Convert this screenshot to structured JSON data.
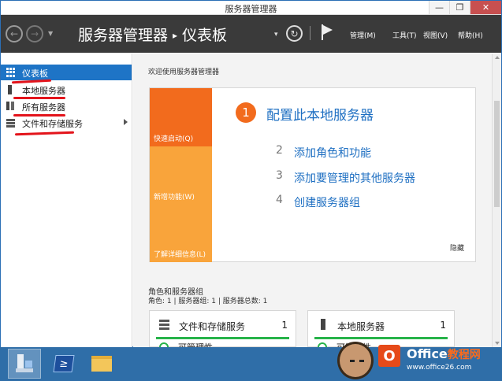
{
  "window": {
    "title": "服务器管理器",
    "minimize": "—",
    "restore": "❐",
    "close": "✕"
  },
  "header": {
    "back": "←",
    "forward": "→",
    "nav_dropdown": "▼",
    "breadcrumb_root": "服务器管理器",
    "breadcrumb_sep": "▸",
    "breadcrumb_current": "仪表板",
    "breadcrumb_dropdown": "▾",
    "refresh": "↻",
    "menus": [
      "管理(M)",
      "工具(T)",
      "视图(V)",
      "帮助(H)"
    ]
  },
  "sidebar": {
    "items": [
      {
        "label": "仪表板",
        "icon": "dashboard-icon",
        "active": true
      },
      {
        "label": "本地服务器",
        "icon": "server-icon",
        "active": false
      },
      {
        "label": "所有服务器",
        "icon": "servers-icon",
        "active": false
      },
      {
        "label": "文件和存储服务",
        "icon": "storage-icon",
        "active": false
      }
    ],
    "annotation_color": "#e3141b"
  },
  "welcome": {
    "title": "欢迎使用服务器管理器",
    "tabs": [
      "快速启动(Q)",
      "新增功能(W)",
      "了解详细信息(L)"
    ],
    "step1": {
      "num": "1",
      "label": "配置此本地服务器"
    },
    "steps": [
      {
        "num": "2",
        "label": "添加角色和功能"
      },
      {
        "num": "3",
        "label": "添加要管理的其他服务器"
      },
      {
        "num": "4",
        "label": "创建服务器组"
      }
    ],
    "hide": "隐藏"
  },
  "roles": {
    "title": "角色和服务器组",
    "summary": "角色: 1 | 服务器组: 1 | 服务器总数: 1",
    "tiles": [
      {
        "name": "文件和存储服务",
        "count": "1",
        "icon": "storage-icon",
        "status": "可管理性"
      },
      {
        "name": "本地服务器",
        "count": "1",
        "icon": "server-icon",
        "status": "可管理性"
      }
    ]
  },
  "taskbar": {
    "apps": [
      "server-manager-icon",
      "powershell-icon",
      "file-explorer-icon"
    ],
    "powershell_glyph": "≥"
  },
  "watermark": {
    "logo": "O",
    "brand": "Office",
    "brand_cn": "教程网",
    "url": "www.office26.com"
  },
  "colors": {
    "accent": "#1e74c6",
    "orange": "#f26b1d",
    "light_orange": "#f9a43b",
    "link_blue": "#1e6fc2",
    "ok_green": "#27b34a",
    "header_bg": "#3a3a3a",
    "taskbar_bg": "#2f6ea8"
  }
}
